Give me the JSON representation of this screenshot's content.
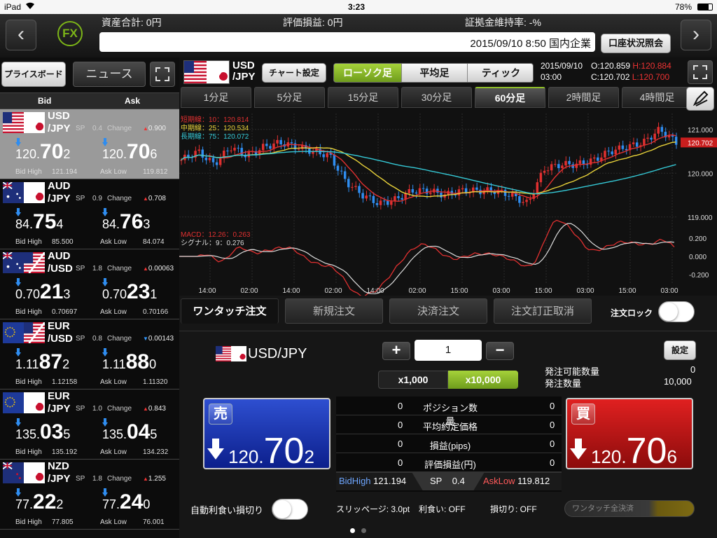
{
  "status": {
    "device": "iPad",
    "time": "3:23",
    "battery": "78%"
  },
  "header": {
    "logo": "FX",
    "total_assets": "資産合計: 0円",
    "unrealized_pl": "評価損益: 0円",
    "margin_ratio": "証拠金維持率: -%",
    "news_ticker": "2015/09/10 8:50 国内企業",
    "account_button": "口座状況照会"
  },
  "left": {
    "tabs": [
      "プライスボード",
      "ニュース"
    ],
    "bid_header": "Bid",
    "ask_header": "Ask",
    "rows": [
      {
        "base": "USD",
        "quote": "/JPY",
        "sp_label": "SP",
        "sp": "0.4",
        "change_label": "Change",
        "change": "0.900",
        "change_dir": "up",
        "bid": [
          "120.",
          "70",
          "2"
        ],
        "ask": [
          "120.",
          "70",
          "6"
        ],
        "bid_high_label": "Bid High",
        "bid_high": "121.194",
        "ask_low_label": "Ask Low",
        "ask_low": "119.812",
        "flag": "usjp"
      },
      {
        "base": "AUD",
        "quote": "/JPY",
        "sp_label": "SP",
        "sp": "0.9",
        "change_label": "Change",
        "change": "0.708",
        "change_dir": "up",
        "bid": [
          "84.",
          "75",
          "4"
        ],
        "ask": [
          "84.",
          "76",
          "3"
        ],
        "bid_high_label": "Bid High",
        "bid_high": "85.500",
        "ask_low_label": "Ask Low",
        "ask_low": "84.074",
        "flag": "aujp"
      },
      {
        "base": "AUD",
        "quote": "/USD",
        "sp_label": "SP",
        "sp": "1.8",
        "change_label": "Change",
        "change": "0.00063",
        "change_dir": "up",
        "bid": [
          "0.70",
          "21",
          "3"
        ],
        "ask": [
          "0.70",
          "23",
          "1"
        ],
        "bid_high_label": "Bid High",
        "bid_high": "0.70697",
        "ask_low_label": "Ask Low",
        "ask_low": "0.70166",
        "flag": "auus"
      },
      {
        "base": "EUR",
        "quote": "/USD",
        "sp_label": "SP",
        "sp": "0.8",
        "change_label": "Change",
        "change": "0.00143",
        "change_dir": "down",
        "bid": [
          "1.11",
          "87",
          "2"
        ],
        "ask": [
          "1.11",
          "88",
          "0"
        ],
        "bid_high_label": "Bid High",
        "bid_high": "1.12158",
        "ask_low_label": "Ask Low",
        "ask_low": "1.11320",
        "flag": "euus"
      },
      {
        "base": "EUR",
        "quote": "/JPY",
        "sp_label": "SP",
        "sp": "1.0",
        "change_label": "Change",
        "change": "0.843",
        "change_dir": "up",
        "bid": [
          "135.",
          "03",
          "5"
        ],
        "ask": [
          "135.",
          "04",
          "5"
        ],
        "bid_high_label": "Bid High",
        "bid_high": "135.192",
        "ask_low_label": "Ask Low",
        "ask_low": "134.232",
        "flag": "eujp"
      },
      {
        "base": "NZD",
        "quote": "/JPY",
        "sp_label": "SP",
        "sp": "1.8",
        "change_label": "Change",
        "change": "1.255",
        "change_dir": "up",
        "bid": [
          "77.",
          "22",
          "2"
        ],
        "ask": [
          "77.",
          "24",
          "0"
        ],
        "bid_high_label": "Bid High",
        "bid_high": "77.805",
        "ask_low_label": "Ask Low",
        "ask_low": "76.001",
        "flag": "nzjp"
      }
    ]
  },
  "chart": {
    "pair_base": "USD",
    "pair_quote": "/JPY",
    "settings": "チャート設定",
    "types": [
      "ローソク足",
      "平均足",
      "ティック"
    ],
    "date": "2015/09/10",
    "time": "03:00",
    "o": "O:120.859",
    "h": "H:120.884",
    "c": "C:120.702",
    "l": "L:120.700",
    "timeframes": [
      "1分足",
      "5分足",
      "15分足",
      "30分足",
      "60分足",
      "2時間足",
      "4時間足"
    ],
    "legend": [
      "短期線：10：120.814",
      "中期線：25：120.534",
      "長期線：75：120.072"
    ],
    "macd_legend": [
      "MACD：12.26：0.263",
      "シグナル：9：0.276"
    ],
    "price_ticks": [
      "121.000",
      "120.000",
      "119.000"
    ],
    "current_price": "120.702",
    "macd_ticks": [
      "0.200",
      "0.000",
      "-0.200"
    ],
    "time_ticks": [
      "14:00",
      "02:00",
      "14:00",
      "02:00",
      "14:00",
      "02:00",
      "15:00",
      "03:00",
      "15:00",
      "03:00",
      "15:00",
      "03:00"
    ]
  },
  "chart_data": {
    "type": "line",
    "title": "",
    "xlabel": "",
    "ylabel": "",
    "ylim": [
      118.9,
      121.3
    ],
    "series": [
      {
        "name": "短期線",
        "last": 120.814
      },
      {
        "name": "中期線",
        "last": 120.534
      },
      {
        "name": "長期線",
        "last": 120.072
      }
    ],
    "close_samples": [
      120.3,
      120.5,
      120.2,
      120.6,
      120.4,
      120.6,
      120.7,
      120.6,
      120.5,
      120.4,
      119.8,
      119.5,
      119.3,
      119.4,
      119.6,
      119.6,
      119.5,
      119.6,
      119.6,
      119.6,
      119.5,
      119.3,
      120.1,
      120.2,
      120.2,
      120.3,
      120.5,
      120.6,
      120.7,
      121.0,
      120.7
    ]
  },
  "order": {
    "tabs": [
      "ワンタッチ注文",
      "新規注文",
      "決済注文",
      "注文訂正取消"
    ],
    "lock_label": "注文ロック",
    "pair": "USD/JPY",
    "qty": "1",
    "plus": "+",
    "minus": "−",
    "settings": "設定",
    "mult": [
      "x1,000",
      "x10,000"
    ],
    "avail_label": "発注可能数量",
    "avail": "0",
    "order_qty_label": "発注数量",
    "order_qty": "10,000",
    "sell_label": "売",
    "sell": [
      "120.",
      "70",
      "2"
    ],
    "buy_label": "買",
    "buy": [
      "120.",
      "70",
      "6"
    ],
    "table": [
      {
        "label": "ポジション数量",
        "l": "0",
        "r": "0"
      },
      {
        "label": "平均約定価格",
        "l": "0",
        "r": "0"
      },
      {
        "label": "損益(pips)",
        "l": "0",
        "r": "0"
      },
      {
        "label": "評価損益(円)",
        "l": "0",
        "r": "0"
      }
    ],
    "bidhigh_label": "BidHigh",
    "bidhigh": "121.194",
    "sp_label": "SP",
    "sp": "0.4",
    "asklow_label": "AskLow",
    "asklow": "119.812",
    "auto_label": "自動利食い損切り",
    "slippage": "スリッページ: 3.0pt",
    "take_profit": "利食い: OFF",
    "stop_loss": "損切り: OFF",
    "close_all": "ワンタッチ全決済"
  },
  "colors": {
    "up": "#e03030",
    "down": "#2f8df0",
    "accent": "#8fbf2a"
  }
}
